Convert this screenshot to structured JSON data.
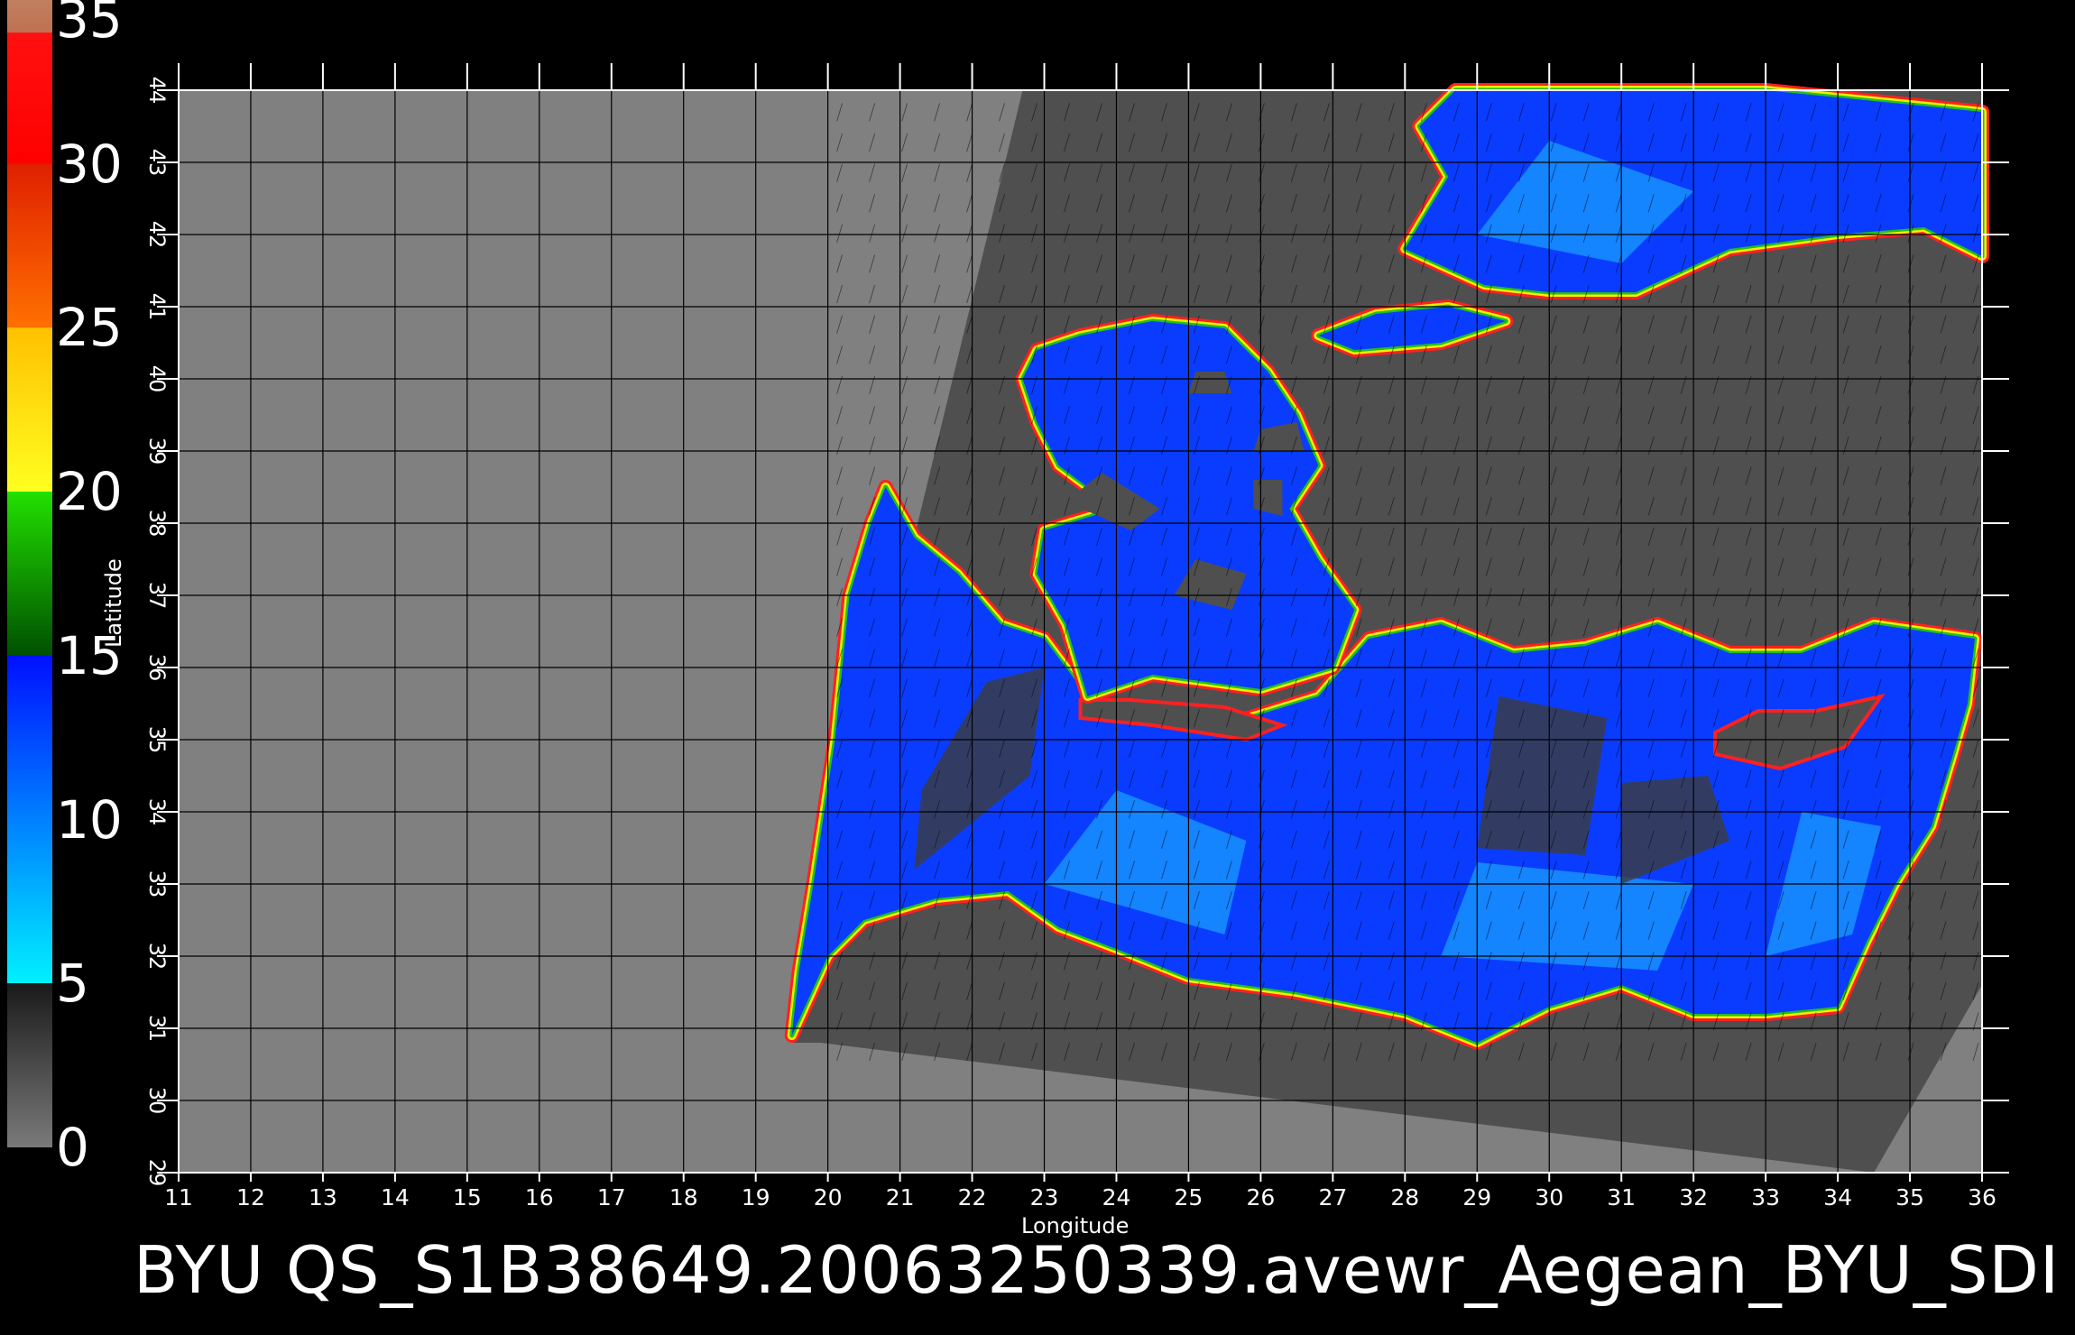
{
  "caption": "BYU  QS_S1B38649.20063250339.avewr_Aegean_BYU_SDI",
  "xlabel": "Longitude",
  "ylabel": "Latitude",
  "colorbar": {
    "labels": [
      "35",
      "30",
      "25",
      "20",
      "15",
      "10",
      "5",
      "0"
    ],
    "stops": [
      {
        "value": 0,
        "color": "#7a7a7a"
      },
      {
        "value": 5,
        "color": "#1a1a1a"
      },
      {
        "value": 5.01,
        "color": "#00f0ff"
      },
      {
        "value": 15,
        "color": "#0010ff"
      },
      {
        "value": 15.01,
        "color": "#005000"
      },
      {
        "value": 20,
        "color": "#22e000"
      },
      {
        "value": 20.01,
        "color": "#ffff20"
      },
      {
        "value": 25,
        "color": "#ffc000"
      },
      {
        "value": 25.01,
        "color": "#ff7000"
      },
      {
        "value": 30,
        "color": "#e02000"
      },
      {
        "value": 30.01,
        "color": "#ff0000"
      },
      {
        "value": 34,
        "color": "#ff1010"
      },
      {
        "value": 34.01,
        "color": "#c07050"
      },
      {
        "value": 35,
        "color": "#c08060"
      }
    ]
  },
  "map": {
    "lon_range": [
      11,
      36
    ],
    "lat_range": [
      29,
      44
    ],
    "lon_ticks": [
      11,
      12,
      13,
      14,
      15,
      16,
      17,
      18,
      19,
      20,
      21,
      22,
      23,
      24,
      25,
      26,
      27,
      28,
      29,
      30,
      31,
      32,
      33,
      34,
      35,
      36
    ],
    "lat_ticks": [
      29,
      30,
      31,
      32,
      33,
      34,
      35,
      36,
      37,
      38,
      39,
      40,
      41,
      42,
      43,
      44
    ],
    "colors": {
      "outside_swath": "#808080",
      "land": "#4f4f4f",
      "sea_low": "#0a3cff",
      "sea_mid": "#1a9cff",
      "coast_green": "#20c020",
      "coast_yellow": "#f0f000",
      "coast_red": "#ff2020",
      "rain_gap": "#3c3c3c",
      "grid": "#000000",
      "wind_vector": "#000000"
    }
  }
}
